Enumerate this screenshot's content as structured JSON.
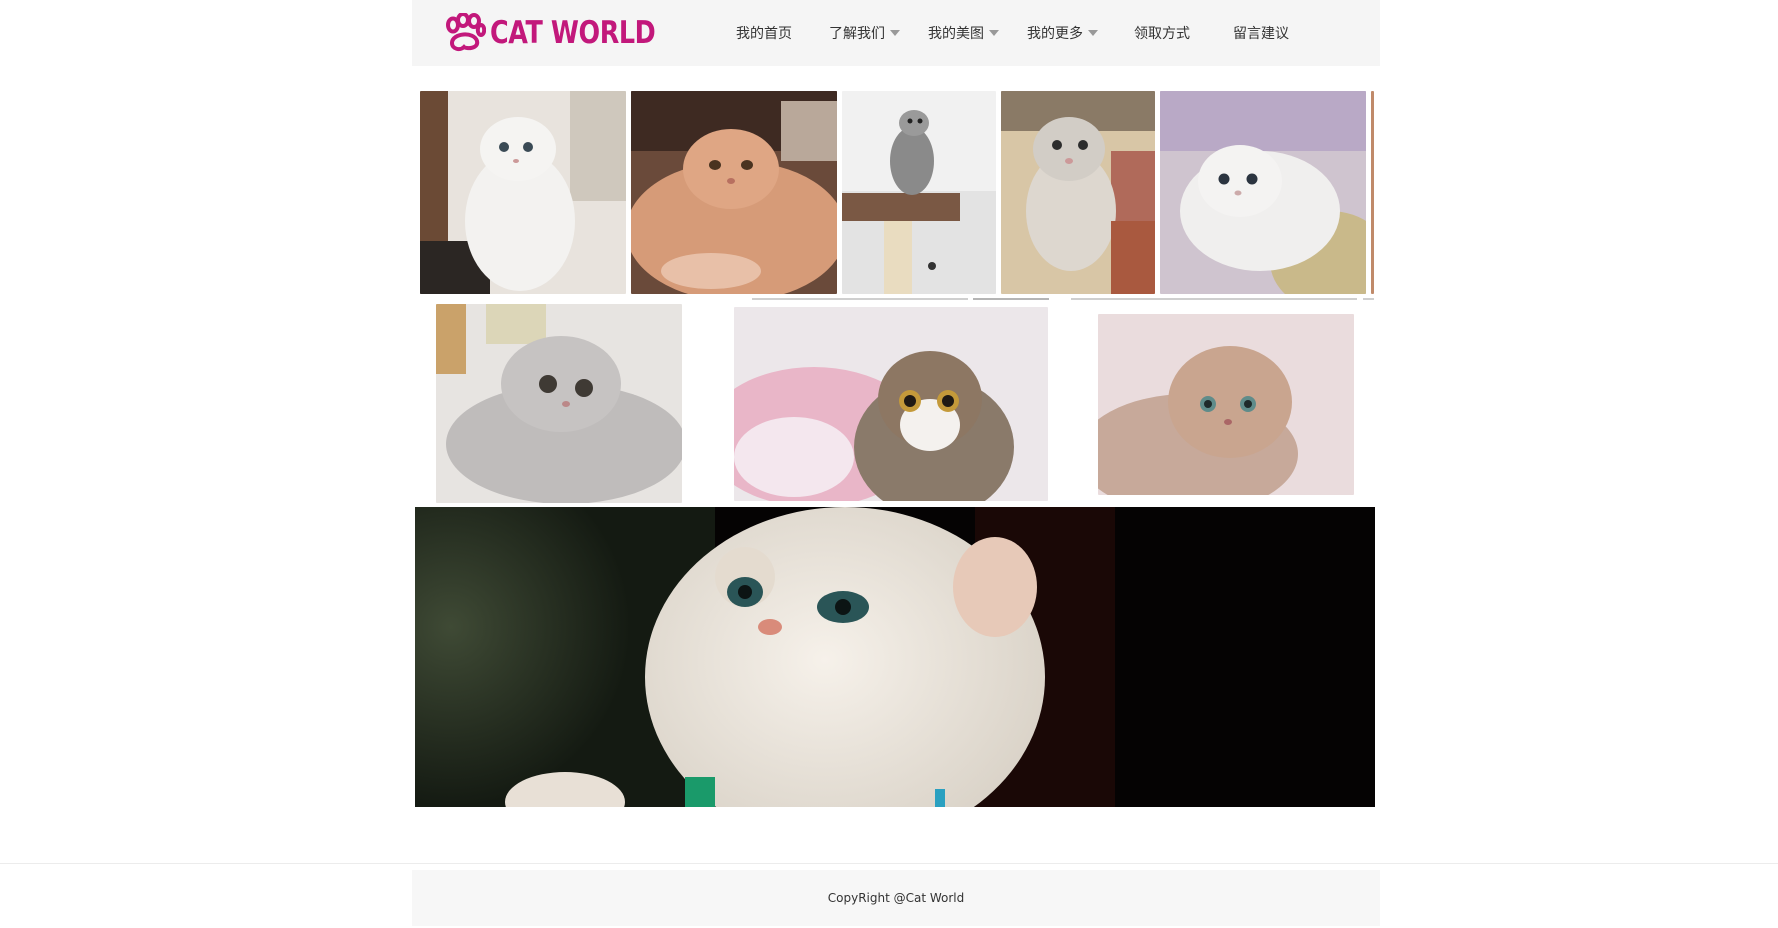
{
  "site": {
    "logo_text": "CAT WORLD",
    "brand_color": "#c2187b",
    "logo_icon": "paw-icon"
  },
  "nav": {
    "items": [
      {
        "label": "我的首页",
        "has_dropdown": false
      },
      {
        "label": "了解我们",
        "has_dropdown": true
      },
      {
        "label": "我的美图",
        "has_dropdown": true
      },
      {
        "label": "我的更多",
        "has_dropdown": true
      },
      {
        "label": "领取方式",
        "has_dropdown": false
      },
      {
        "label": "留言建议",
        "has_dropdown": false
      }
    ],
    "dropdown_icon": "caret-down-icon"
  },
  "footer": {
    "copyright": "CopyRight  @Cat World"
  }
}
